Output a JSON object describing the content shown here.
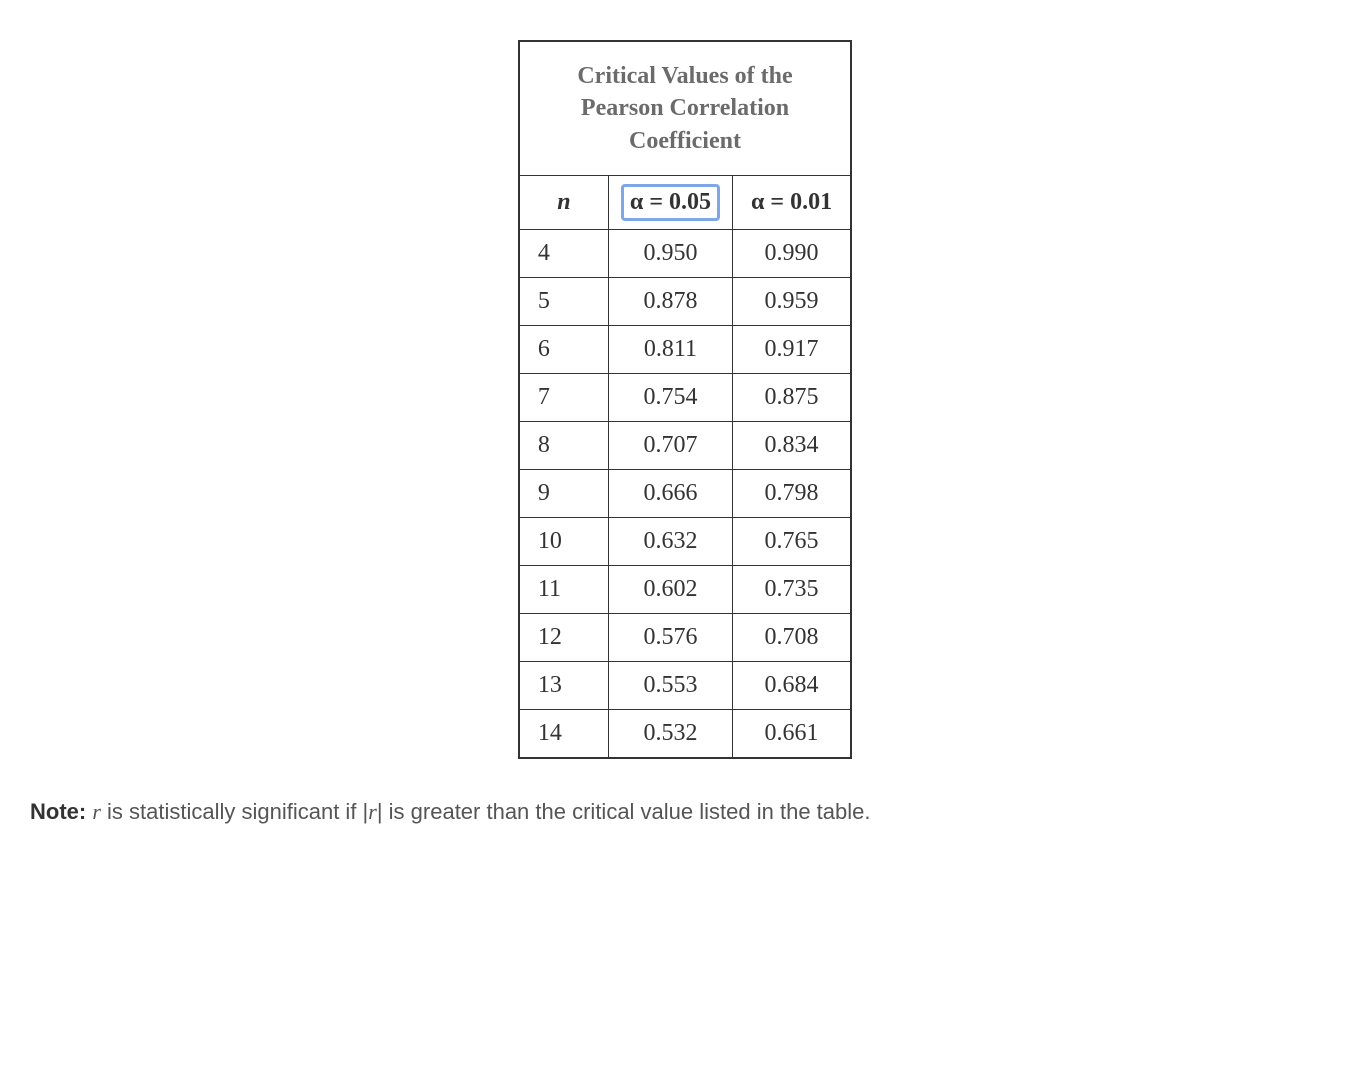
{
  "chart_data": {
    "type": "table",
    "title": "Critical Values of the Pearson Correlation Coefficient",
    "columns": [
      "n",
      "α = 0.05",
      "α = 0.01"
    ],
    "rows": [
      {
        "n": 4,
        "a05": "0.950",
        "a01": "0.990"
      },
      {
        "n": 5,
        "a05": "0.878",
        "a01": "0.959"
      },
      {
        "n": 6,
        "a05": "0.811",
        "a01": "0.917"
      },
      {
        "n": 7,
        "a05": "0.754",
        "a01": "0.875"
      },
      {
        "n": 8,
        "a05": "0.707",
        "a01": "0.834"
      },
      {
        "n": 9,
        "a05": "0.666",
        "a01": "0.798"
      },
      {
        "n": 10,
        "a05": "0.632",
        "a01": "0.765"
      },
      {
        "n": 11,
        "a05": "0.602",
        "a01": "0.735"
      },
      {
        "n": 12,
        "a05": "0.576",
        "a01": "0.708"
      },
      {
        "n": 13,
        "a05": "0.553",
        "a01": "0.684"
      },
      {
        "n": 14,
        "a05": "0.532",
        "a01": "0.661"
      }
    ],
    "highlighted_column": "α = 0.05"
  },
  "table": {
    "title_l1": "Critical Values of the",
    "title_l2": "Pearson Correlation",
    "title_l3": "Coefficient",
    "header_n": "n",
    "header_a05": "α = 0.05",
    "header_a01": "α = 0.01"
  },
  "note": {
    "label": "Note:",
    "part1": " is statistically significant if ",
    "part2": " is greater than the critical value listed in the table.",
    "r": "r",
    "abs_r": "|r|"
  }
}
